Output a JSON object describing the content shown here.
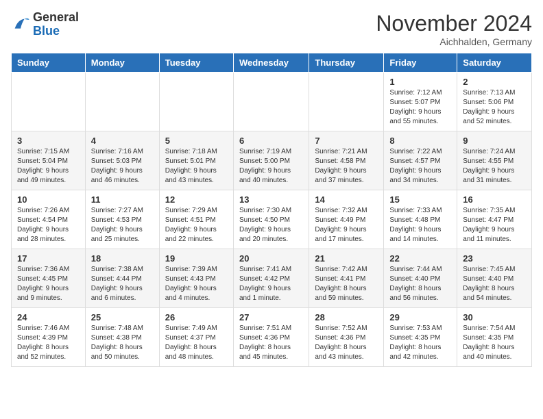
{
  "header": {
    "logo_general": "General",
    "logo_blue": "Blue",
    "month": "November 2024",
    "location": "Aichhalden, Germany"
  },
  "weekdays": [
    "Sunday",
    "Monday",
    "Tuesday",
    "Wednesday",
    "Thursday",
    "Friday",
    "Saturday"
  ],
  "weeks": [
    [
      {
        "day": "",
        "info": ""
      },
      {
        "day": "",
        "info": ""
      },
      {
        "day": "",
        "info": ""
      },
      {
        "day": "",
        "info": ""
      },
      {
        "day": "",
        "info": ""
      },
      {
        "day": "1",
        "info": "Sunrise: 7:12 AM\nSunset: 5:07 PM\nDaylight: 9 hours\nand 55 minutes."
      },
      {
        "day": "2",
        "info": "Sunrise: 7:13 AM\nSunset: 5:06 PM\nDaylight: 9 hours\nand 52 minutes."
      }
    ],
    [
      {
        "day": "3",
        "info": "Sunrise: 7:15 AM\nSunset: 5:04 PM\nDaylight: 9 hours\nand 49 minutes."
      },
      {
        "day": "4",
        "info": "Sunrise: 7:16 AM\nSunset: 5:03 PM\nDaylight: 9 hours\nand 46 minutes."
      },
      {
        "day": "5",
        "info": "Sunrise: 7:18 AM\nSunset: 5:01 PM\nDaylight: 9 hours\nand 43 minutes."
      },
      {
        "day": "6",
        "info": "Sunrise: 7:19 AM\nSunset: 5:00 PM\nDaylight: 9 hours\nand 40 minutes."
      },
      {
        "day": "7",
        "info": "Sunrise: 7:21 AM\nSunset: 4:58 PM\nDaylight: 9 hours\nand 37 minutes."
      },
      {
        "day": "8",
        "info": "Sunrise: 7:22 AM\nSunset: 4:57 PM\nDaylight: 9 hours\nand 34 minutes."
      },
      {
        "day": "9",
        "info": "Sunrise: 7:24 AM\nSunset: 4:55 PM\nDaylight: 9 hours\nand 31 minutes."
      }
    ],
    [
      {
        "day": "10",
        "info": "Sunrise: 7:26 AM\nSunset: 4:54 PM\nDaylight: 9 hours\nand 28 minutes."
      },
      {
        "day": "11",
        "info": "Sunrise: 7:27 AM\nSunset: 4:53 PM\nDaylight: 9 hours\nand 25 minutes."
      },
      {
        "day": "12",
        "info": "Sunrise: 7:29 AM\nSunset: 4:51 PM\nDaylight: 9 hours\nand 22 minutes."
      },
      {
        "day": "13",
        "info": "Sunrise: 7:30 AM\nSunset: 4:50 PM\nDaylight: 9 hours\nand 20 minutes."
      },
      {
        "day": "14",
        "info": "Sunrise: 7:32 AM\nSunset: 4:49 PM\nDaylight: 9 hours\nand 17 minutes."
      },
      {
        "day": "15",
        "info": "Sunrise: 7:33 AM\nSunset: 4:48 PM\nDaylight: 9 hours\nand 14 minutes."
      },
      {
        "day": "16",
        "info": "Sunrise: 7:35 AM\nSunset: 4:47 PM\nDaylight: 9 hours\nand 11 minutes."
      }
    ],
    [
      {
        "day": "17",
        "info": "Sunrise: 7:36 AM\nSunset: 4:45 PM\nDaylight: 9 hours\nand 9 minutes."
      },
      {
        "day": "18",
        "info": "Sunrise: 7:38 AM\nSunset: 4:44 PM\nDaylight: 9 hours\nand 6 minutes."
      },
      {
        "day": "19",
        "info": "Sunrise: 7:39 AM\nSunset: 4:43 PM\nDaylight: 9 hours\nand 4 minutes."
      },
      {
        "day": "20",
        "info": "Sunrise: 7:41 AM\nSunset: 4:42 PM\nDaylight: 9 hours\nand 1 minute."
      },
      {
        "day": "21",
        "info": "Sunrise: 7:42 AM\nSunset: 4:41 PM\nDaylight: 8 hours\nand 59 minutes."
      },
      {
        "day": "22",
        "info": "Sunrise: 7:44 AM\nSunset: 4:40 PM\nDaylight: 8 hours\nand 56 minutes."
      },
      {
        "day": "23",
        "info": "Sunrise: 7:45 AM\nSunset: 4:40 PM\nDaylight: 8 hours\nand 54 minutes."
      }
    ],
    [
      {
        "day": "24",
        "info": "Sunrise: 7:46 AM\nSunset: 4:39 PM\nDaylight: 8 hours\nand 52 minutes."
      },
      {
        "day": "25",
        "info": "Sunrise: 7:48 AM\nSunset: 4:38 PM\nDaylight: 8 hours\nand 50 minutes."
      },
      {
        "day": "26",
        "info": "Sunrise: 7:49 AM\nSunset: 4:37 PM\nDaylight: 8 hours\nand 48 minutes."
      },
      {
        "day": "27",
        "info": "Sunrise: 7:51 AM\nSunset: 4:36 PM\nDaylight: 8 hours\nand 45 minutes."
      },
      {
        "day": "28",
        "info": "Sunrise: 7:52 AM\nSunset: 4:36 PM\nDaylight: 8 hours\nand 43 minutes."
      },
      {
        "day": "29",
        "info": "Sunrise: 7:53 AM\nSunset: 4:35 PM\nDaylight: 8 hours\nand 42 minutes."
      },
      {
        "day": "30",
        "info": "Sunrise: 7:54 AM\nSunset: 4:35 PM\nDaylight: 8 hours\nand 40 minutes."
      }
    ]
  ]
}
